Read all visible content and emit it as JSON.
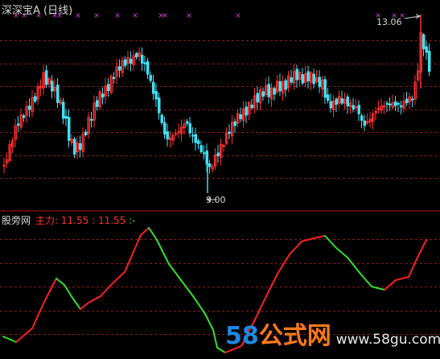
{
  "window": {
    "title": "深深宝A (日线)"
  },
  "indicator": {
    "name": "股旁网",
    "line_label": "主力:",
    "value1": "11.55",
    "separator": ":",
    "value2": "11.55",
    "suffix": ":-"
  },
  "annotations": {
    "high": "13.06",
    "low": "9.00"
  },
  "watermark": {
    "number": "58",
    "brand": "公式网",
    "url": "www.58gu.com"
  },
  "colors": {
    "up": "#ff3030",
    "down": "#40e0f0",
    "grid": "#8b1a1a",
    "line_up": "#ff2020",
    "line_down": "#30e030",
    "marker": "#e040e0"
  },
  "chart_data": {
    "type": "candlestick",
    "price_range": [
      9.0,
      13.06
    ],
    "indicator_name": "股旁网",
    "indicator_line": "主力",
    "indicator_last_value": 11.55
  }
}
